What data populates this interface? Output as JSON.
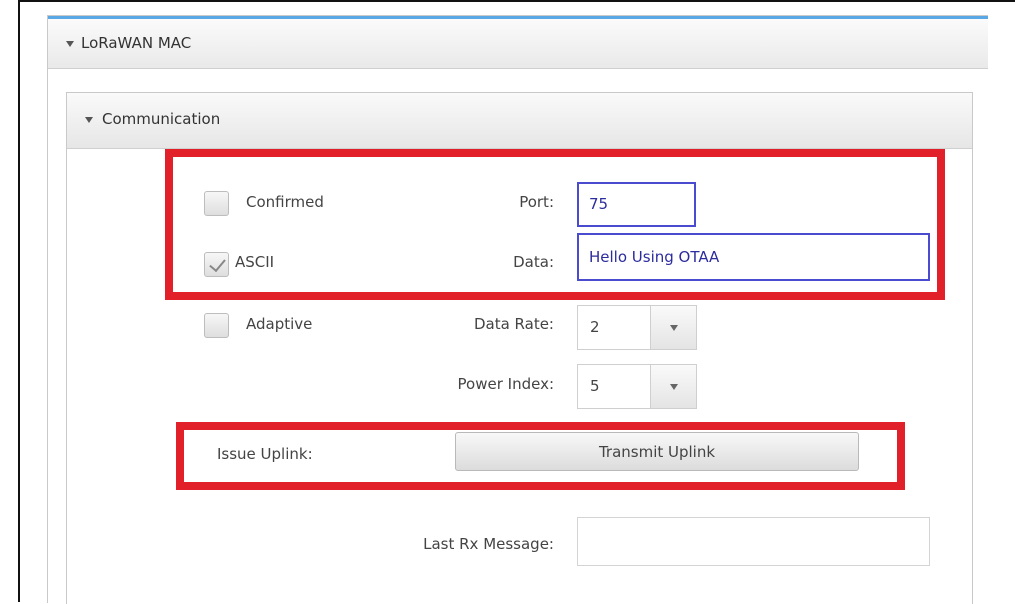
{
  "panels": {
    "outer_title": "LoRaWAN MAC",
    "inner_title": "Communication"
  },
  "options": {
    "confirmed": {
      "label": "Confirmed",
      "checked": false
    },
    "ascii": {
      "label": "ASCII",
      "checked": true
    },
    "adaptive": {
      "label": "Adaptive",
      "checked": false
    }
  },
  "fields": {
    "port": {
      "label": "Port:",
      "value": "75"
    },
    "data": {
      "label": "Data:",
      "value": "Hello Using OTAA"
    },
    "data_rate": {
      "label": "Data Rate:",
      "value": "2"
    },
    "power_index": {
      "label": "Power Index:",
      "value": "5"
    },
    "last_rx": {
      "label": "Last Rx Message:",
      "value": ""
    }
  },
  "uplink": {
    "label": "Issue Uplink:",
    "button": "Transmit Uplink"
  },
  "colors": {
    "highlight": "#e2202a",
    "header_accent": "#5aa7e6",
    "focus_border": "#4b4bd0",
    "input_text": "#2c2c9e"
  }
}
